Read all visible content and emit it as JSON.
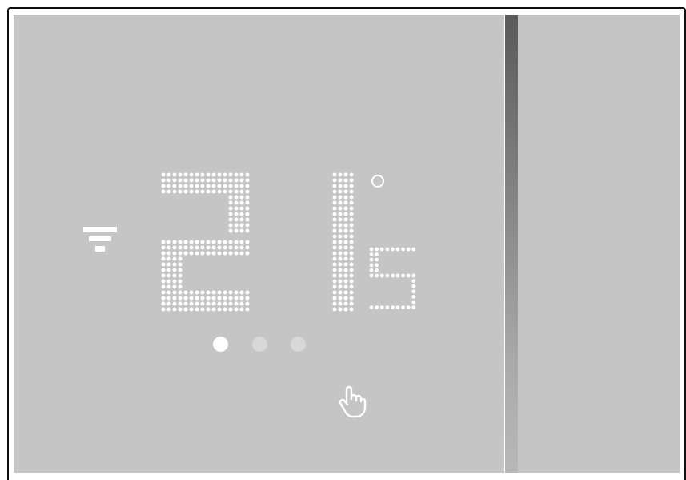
{
  "device": {
    "display": {
      "temperature": {
        "integer": "21",
        "decimal": "5",
        "unit_symbol": "°"
      },
      "mode_icon": "heating-icon",
      "pager": {
        "count": 3,
        "active_index": 0
      },
      "hint_icon": "touch-hand-icon"
    },
    "colors": {
      "screen_bg": "#c5c5c5",
      "segment": "#ffffff",
      "dot_inactive": "#d8d8d8",
      "frame": "#111111"
    }
  }
}
